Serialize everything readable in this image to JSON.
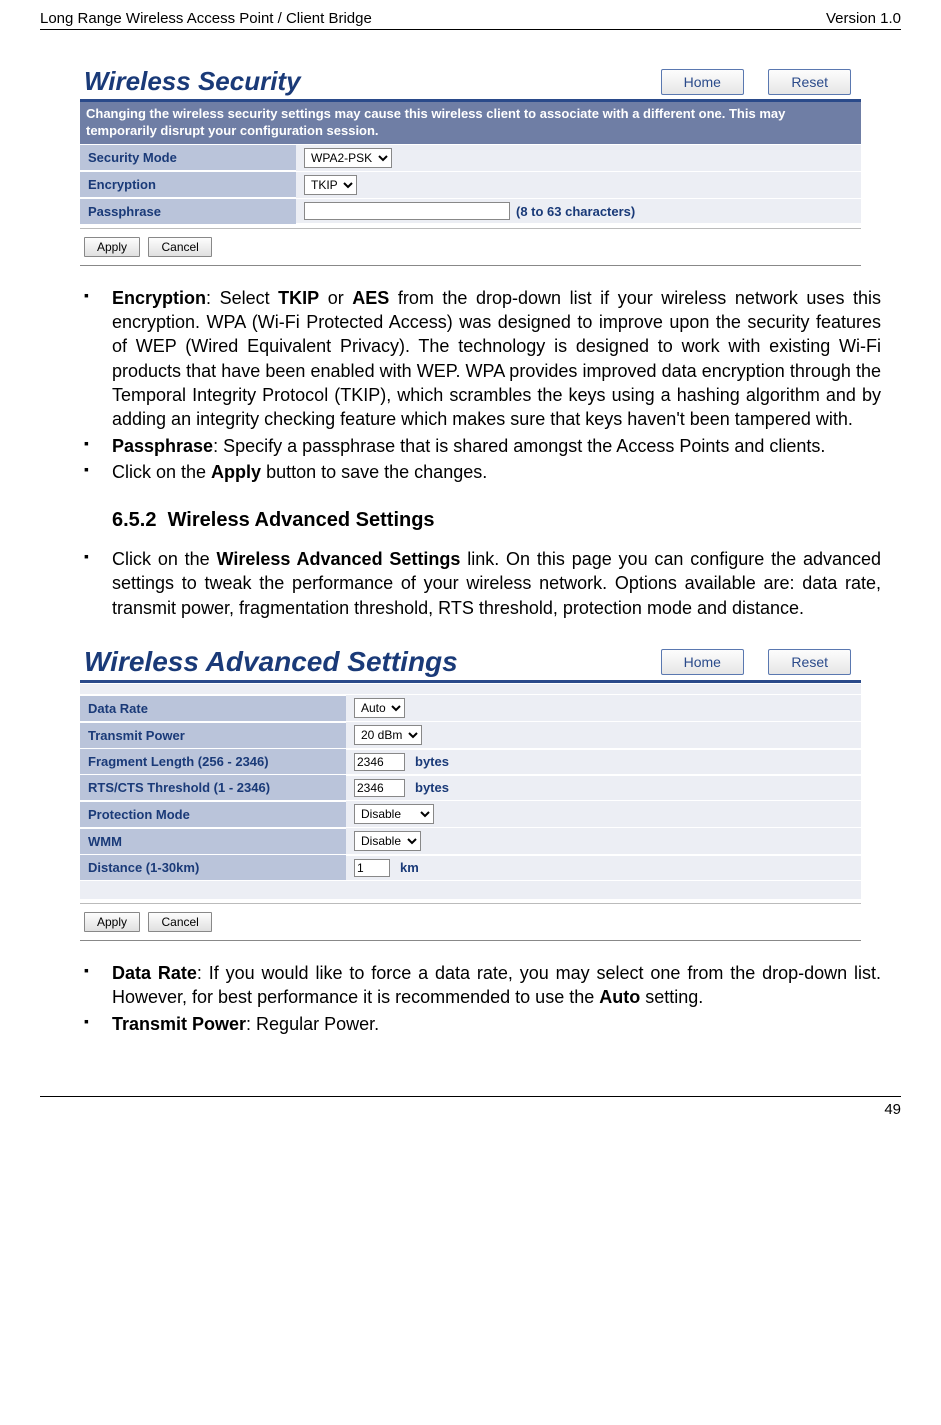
{
  "header": {
    "left": "Long Range Wireless Access Point / Client Bridge",
    "right": "Version 1.0"
  },
  "panel1": {
    "title": "Wireless Security",
    "home": "Home",
    "reset": "Reset",
    "info": "Changing the wireless security settings may cause this wireless client to associate with a different one. This may temporarily disrupt your configuration session.",
    "rows": {
      "secmode_label": "Security Mode",
      "secmode_value": "WPA2-PSK",
      "enc_label": "Encryption",
      "enc_value": "TKIP",
      "pass_label": "Passphrase",
      "pass_value": "",
      "pass_hint": "(8 to 63 characters)"
    },
    "apply": "Apply",
    "cancel": "Cancel"
  },
  "text1": {
    "b1_bold": "Encryption",
    "b1_rest": ": Select ",
    "b1_tkip": "TKIP",
    "b1_mid": " or ",
    "b1_aes": "AES",
    "b1_tail": " from the drop-down list if your wireless network uses this encryption. WPA (Wi-Fi Protected Access) was designed to improve upon the security features of WEP (Wired Equivalent Privacy). The technology is designed to work with existing Wi-Fi products that have been enabled with WEP. WPA provides improved data encryption through the Temporal Integrity Protocol (TKIP), which scrambles the keys using a hashing algorithm and by adding an integrity checking feature which makes sure that keys haven't been tampered with.",
    "b2_bold": "Passphrase",
    "b2_tail": ": Specify a passphrase that is shared amongst the Access Points and clients.",
    "b3_pre": "Click on the ",
    "b3_bold": "Apply",
    "b3_tail": " button to save the changes."
  },
  "section": {
    "num": "6.5.2",
    "title": "Wireless Advanced Settings"
  },
  "text2": {
    "pre": "Click on the ",
    "bold": "Wireless Advanced Settings",
    "tail": " link. On this page you can configure the advanced settings to tweak the performance of your wireless network. Options available are: data rate, transmit power, fragmentation threshold, RTS threshold, protection mode and distance."
  },
  "panel2": {
    "title": "Wireless Advanced Settings",
    "home": "Home",
    "reset": "Reset",
    "rows": {
      "datarate_label": "Data Rate",
      "datarate_value": "Auto",
      "txpower_label": "Transmit Power",
      "txpower_value": "20 dBm",
      "frag_label": "Fragment Length (256 - 2346)",
      "frag_value": "2346",
      "frag_unit": "bytes",
      "rts_label": "RTS/CTS Threshold (1 - 2346)",
      "rts_value": "2346",
      "rts_unit": "bytes",
      "prot_label": "Protection Mode",
      "prot_value": "Disable",
      "wmm_label": "WMM",
      "wmm_value": "Disable",
      "dist_label": "Distance (1-30km)",
      "dist_value": "1",
      "dist_unit": "km"
    },
    "apply": "Apply",
    "cancel": "Cancel"
  },
  "text3": {
    "b1_bold": "Data Rate",
    "b1_mid": ": If you would like to force a data rate, you may select one from the drop-down list. However, for best performance it is recommended to use the ",
    "b1_auto": "Auto",
    "b1_tail": " setting.",
    "b2_bold": "Transmit Power",
    "b2_tail": ": Regular Power."
  },
  "footer": {
    "page": "49"
  }
}
